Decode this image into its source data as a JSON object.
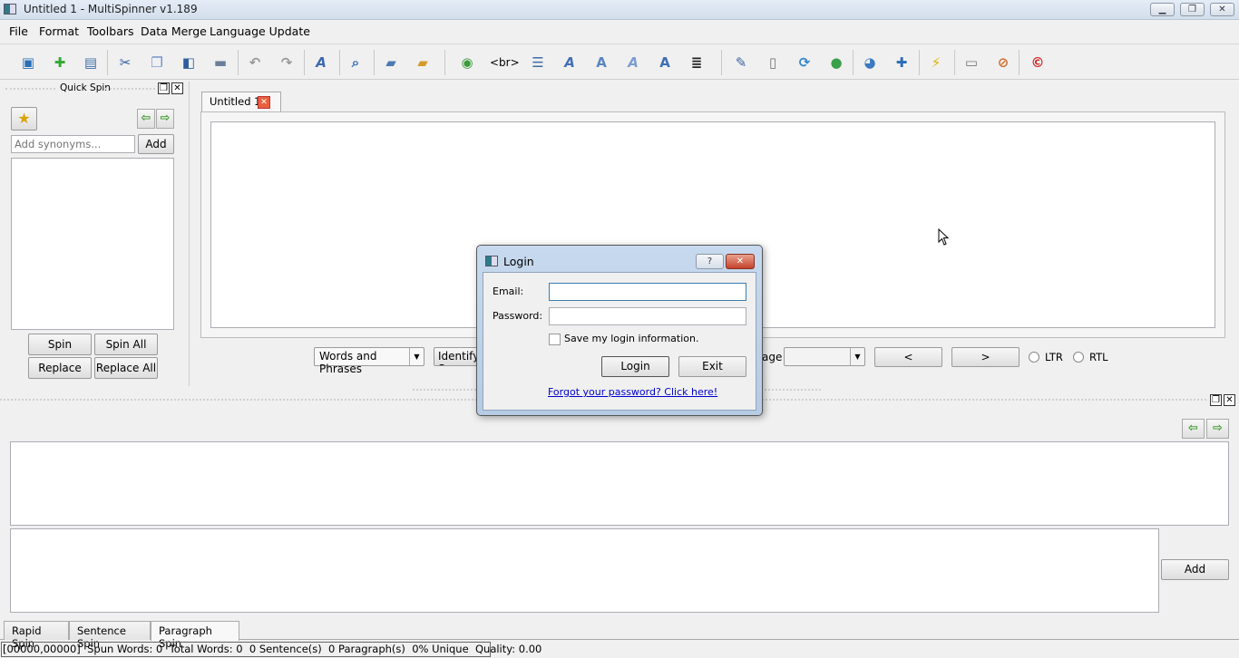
{
  "window": {
    "title": "Untitled 1 - MultiSpinner v1.189",
    "minimize": "▁",
    "restore": "❐",
    "close": "✕"
  },
  "menu": [
    "File",
    "Format",
    "Toolbars",
    "Data Merge",
    "Language Update"
  ],
  "toolbar": {
    "br_label": "<br>",
    "icons": [
      "open-icon",
      "new-document-icon",
      "save-icon",
      "cut-icon",
      "copy-icon",
      "paste-icon",
      "print-icon",
      "undo-icon",
      "redo-icon",
      "font-icon",
      "find-icon",
      "folder-icon",
      "user-folder-icon",
      "web-icon",
      "br-tag",
      "list-icon",
      "font-italic-icon",
      "font-outline-icon",
      "font-light-icon",
      "font-bold-icon",
      "text-align-icon",
      "edit-notes-icon",
      "document-icon",
      "refresh-icon",
      "globe-icon",
      "page-web-icon",
      "add-icon",
      "flash-add-icon",
      "monitor-icon",
      "tag-remove-icon",
      "copyright-icon"
    ]
  },
  "quick_spin": {
    "title": "Quick Spin",
    "synonym_placeholder": "Add synonyms...",
    "add": "Add",
    "spin": "Spin",
    "spin_all": "Spin All",
    "replace": "Replace",
    "replace_all": "Replace All"
  },
  "editor": {
    "tab": "Untitled 1"
  },
  "controls": {
    "mode": "Words and Phrases",
    "identify": "Identify S",
    "language_label": "age",
    "language_value": "",
    "prev": "<",
    "next": ">",
    "ltr": "LTR",
    "rtl": "RTL"
  },
  "paragraph": {
    "add": "Add"
  },
  "bottom_tabs": [
    "Rapid Spin",
    "Sentence Spin",
    "Paragraph Spin"
  ],
  "status": "[00000,00000]  Spun Words: 0  Total Words: 0  0 Sentence(s)  0 Paragraph(s)  0% Unique  Quality: 0.00",
  "login": {
    "title": "Login",
    "help": "?",
    "close": "✕",
    "email_label": "Email:",
    "email_value": "",
    "password_label": "Password:",
    "password_value": "",
    "save_label": "Save my login information.",
    "save_checked": false,
    "login_button": "Login",
    "exit_button": "Exit",
    "forgot_link": "Forgot your password? Click here!"
  }
}
